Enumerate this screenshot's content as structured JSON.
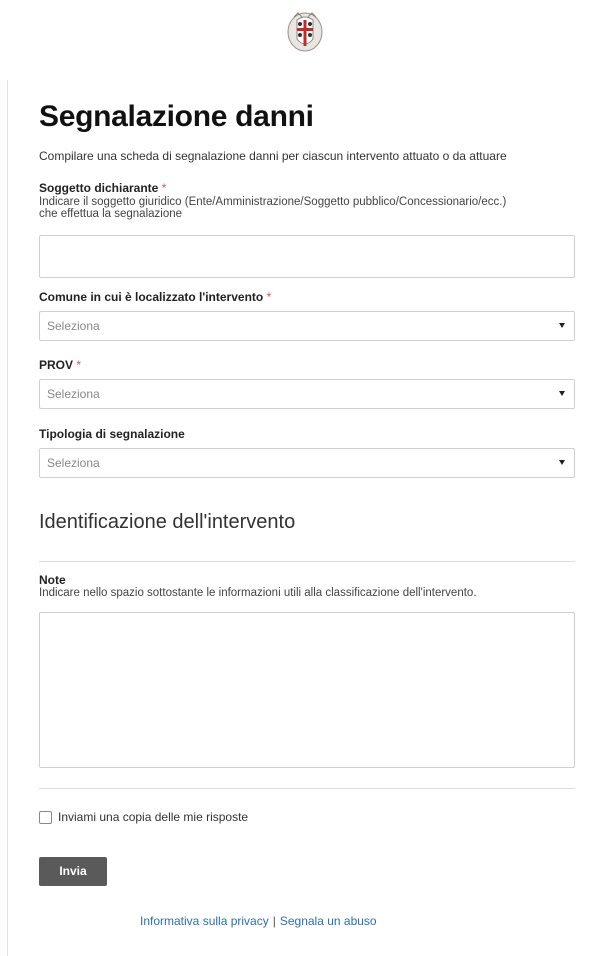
{
  "logo": {
    "icon": "sardinia-coat-of-arms-icon"
  },
  "form": {
    "title": "Segnalazione danni",
    "description": "Compilare una scheda di segnalazione danni per ciascun intervento attuato o da attuare",
    "soggetto": {
      "label": "Soggetto dichiarante",
      "required_mark": "*",
      "help_line1": "Indicare il soggetto giuridico (Ente/Amministrazione/Soggetto pubblico/Concessionario/ecc.)",
      "help_line2": "che effettua la segnalazione",
      "value": ""
    },
    "comune": {
      "label": "Comune in cui è localizzato l'intervento",
      "required_mark": "*",
      "selected": "Seleziona"
    },
    "prov": {
      "label": "PROV",
      "required_mark": "*",
      "selected": "Seleziona"
    },
    "tipologia": {
      "label": "Tipologia di segnalazione",
      "selected": "Seleziona"
    },
    "section_title": "Identificazione dell'intervento",
    "note": {
      "label": "Note",
      "help": "Indicare nello spazio sottostante le informazioni utili alla classificazione dell'intervento.",
      "value": ""
    },
    "copy_checkbox": {
      "label": "Inviami una copia delle mie risposte",
      "checked": false
    },
    "submit_label": "Invia"
  },
  "footer": {
    "privacy": "Informativa sulla privacy",
    "separator": "|",
    "abuse": "Segnala un abuso"
  },
  "colors": {
    "required": "#d9534f",
    "button": "#5a5a5a",
    "link": "#2a6fb8"
  }
}
